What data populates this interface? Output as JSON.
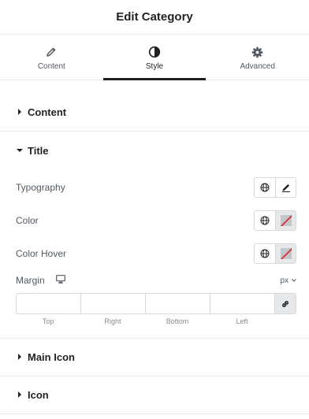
{
  "header": {
    "title": "Edit Category"
  },
  "tabs": [
    {
      "label": "Content",
      "icon": "pencil-icon"
    },
    {
      "label": "Style",
      "icon": "contrast-icon",
      "active": true
    },
    {
      "label": "Advanced",
      "icon": "gear-icon"
    }
  ],
  "sections": {
    "content": {
      "label": "Content",
      "expanded": false
    },
    "title": {
      "label": "Title",
      "expanded": true
    },
    "main_icon": {
      "label": "Main Icon",
      "expanded": false
    },
    "icon": {
      "label": "Icon",
      "expanded": false
    }
  },
  "title_controls": {
    "typography": {
      "label": "Typography"
    },
    "color": {
      "label": "Color"
    },
    "color_hover": {
      "label": "Color Hover"
    },
    "margin": {
      "label": "Margin",
      "unit": "px",
      "fields": [
        {
          "label": "Top",
          "value": ""
        },
        {
          "label": "Right",
          "value": ""
        },
        {
          "label": "Bottom",
          "value": ""
        },
        {
          "label": "Left",
          "value": ""
        }
      ]
    }
  },
  "colors": {
    "text": "#1f2124",
    "muted": "#515962",
    "border": "#d5d8dc",
    "unset_slash": "#d93a3a"
  }
}
